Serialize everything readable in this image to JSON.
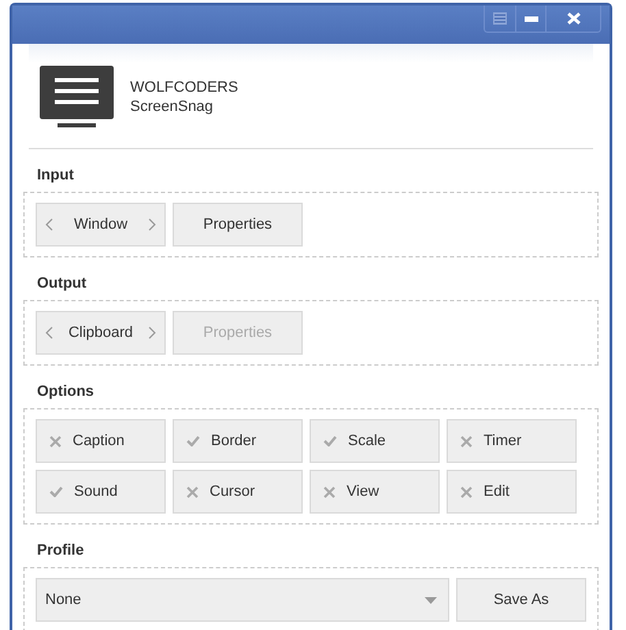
{
  "header": {
    "company": "WOLFCODERS",
    "product": "ScreenSnag"
  },
  "input": {
    "title": "Input",
    "selector": {
      "value": "Window",
      "disabled": false
    },
    "properties": {
      "label": "Properties",
      "disabled": false
    }
  },
  "output": {
    "title": "Output",
    "selector": {
      "value": "Clipboard",
      "disabled": false
    },
    "properties": {
      "label": "Properties",
      "disabled": true
    }
  },
  "options": {
    "title": "Options",
    "items": [
      {
        "label": "Caption",
        "checked": false
      },
      {
        "label": "Border",
        "checked": true
      },
      {
        "label": "Scale",
        "checked": true
      },
      {
        "label": "Timer",
        "checked": false
      },
      {
        "label": "Sound",
        "checked": true
      },
      {
        "label": "Cursor",
        "checked": false
      },
      {
        "label": "View",
        "checked": false
      },
      {
        "label": "Edit",
        "checked": false
      }
    ]
  },
  "profile": {
    "title": "Profile",
    "value": "None",
    "save_button": "Save As"
  }
}
